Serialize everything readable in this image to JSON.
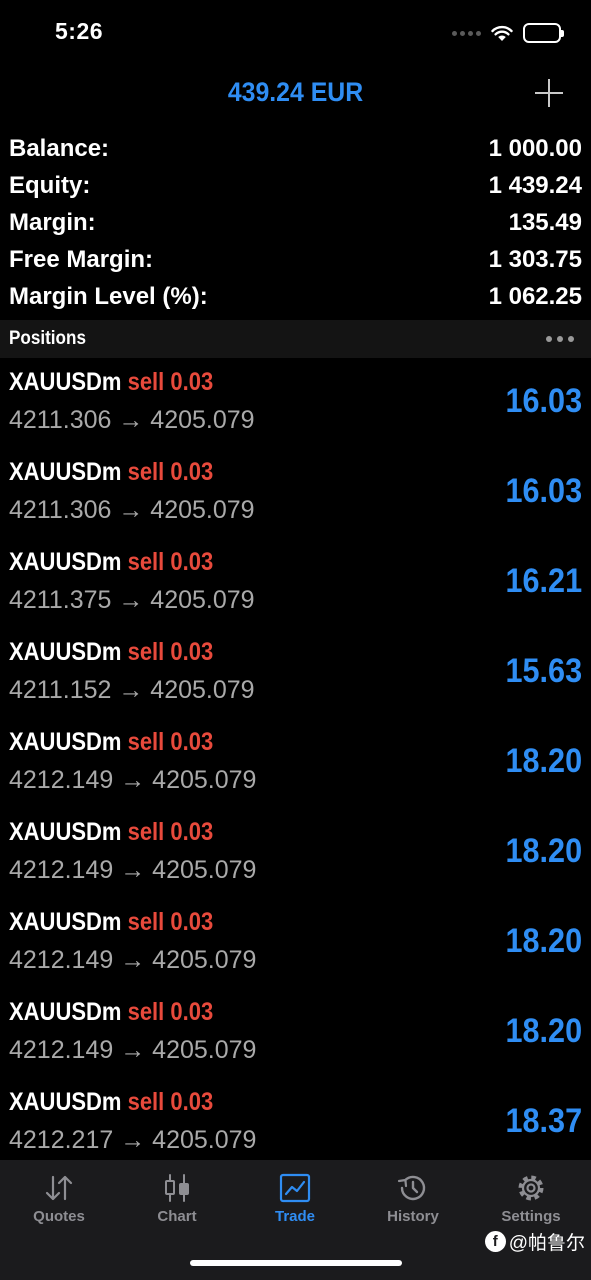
{
  "status": {
    "time": "5:26"
  },
  "header": {
    "title": "439.24 EUR"
  },
  "summary": [
    {
      "label": "Balance:",
      "value": "1 000.00"
    },
    {
      "label": "Equity:",
      "value": "1 439.24"
    },
    {
      "label": "Margin:",
      "value": "135.49"
    },
    {
      "label": "Free Margin:",
      "value": "1 303.75"
    },
    {
      "label": "Margin Level (%):",
      "value": "1 062.25"
    }
  ],
  "positions_section": {
    "title": "Positions"
  },
  "positions": [
    {
      "symbol": "XAUUSDm",
      "side": "sell 0.03",
      "prices": "4211.306 → 4205.079",
      "profit": "16.03"
    },
    {
      "symbol": "XAUUSDm",
      "side": "sell 0.03",
      "prices": "4211.306 → 4205.079",
      "profit": "16.03"
    },
    {
      "symbol": "XAUUSDm",
      "side": "sell 0.03",
      "prices": "4211.375 → 4205.079",
      "profit": "16.21"
    },
    {
      "symbol": "XAUUSDm",
      "side": "sell 0.03",
      "prices": "4211.152 → 4205.079",
      "profit": "15.63"
    },
    {
      "symbol": "XAUUSDm",
      "side": "sell 0.03",
      "prices": "4212.149 → 4205.079",
      "profit": "18.20"
    },
    {
      "symbol": "XAUUSDm",
      "side": "sell 0.03",
      "prices": "4212.149 → 4205.079",
      "profit": "18.20"
    },
    {
      "symbol": "XAUUSDm",
      "side": "sell 0.03",
      "prices": "4212.149 → 4205.079",
      "profit": "18.20"
    },
    {
      "symbol": "XAUUSDm",
      "side": "sell 0.03",
      "prices": "4212.149 → 4205.079",
      "profit": "18.20"
    },
    {
      "symbol": "XAUUSDm",
      "side": "sell 0.03",
      "prices": "4212.217 → 4205.079",
      "profit": "18.37"
    }
  ],
  "tabs": [
    {
      "label": "Quotes",
      "icon": "quotes-icon"
    },
    {
      "label": "Chart",
      "icon": "chart-icon"
    },
    {
      "label": "Trade",
      "icon": "trade-icon",
      "active": true
    },
    {
      "label": "History",
      "icon": "history-icon"
    },
    {
      "label": "Settings",
      "icon": "settings-icon"
    }
  ],
  "watermark": {
    "text": "@帕鲁尔"
  },
  "colors": {
    "accent": "#2f8df3",
    "sell": "#e84a3c",
    "muted": "#a9a9a9",
    "tab_inactive": "#8e8e93"
  }
}
